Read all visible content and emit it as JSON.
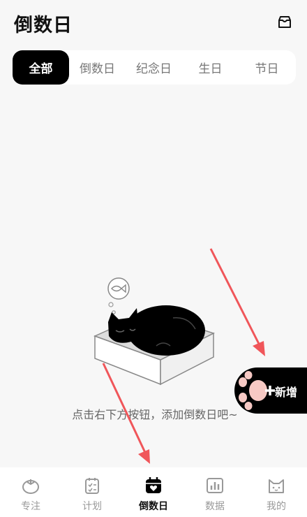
{
  "header": {
    "title": "倒数日"
  },
  "tabs": [
    {
      "label": "全部",
      "active": true
    },
    {
      "label": "倒数日",
      "active": false
    },
    {
      "label": "纪念日",
      "active": false
    },
    {
      "label": "生日",
      "active": false
    },
    {
      "label": "节日",
      "active": false
    }
  ],
  "empty_state": {
    "hint": "点击右下方按钮，添加倒数日吧~"
  },
  "add_button": {
    "label": "新增"
  },
  "tabbar": [
    {
      "label": "专注",
      "icon": "tomato-icon",
      "active": false
    },
    {
      "label": "计划",
      "icon": "checklist-icon",
      "active": false
    },
    {
      "label": "倒数日",
      "icon": "calendar-heart-icon",
      "active": true
    },
    {
      "label": "数据",
      "icon": "bar-chart-icon",
      "active": false
    },
    {
      "label": "我的",
      "icon": "cat-face-icon",
      "active": false
    }
  ],
  "colors": {
    "accent": "#000000",
    "annotation_arrow": "#f0565a",
    "background": "#f7f7f7"
  }
}
